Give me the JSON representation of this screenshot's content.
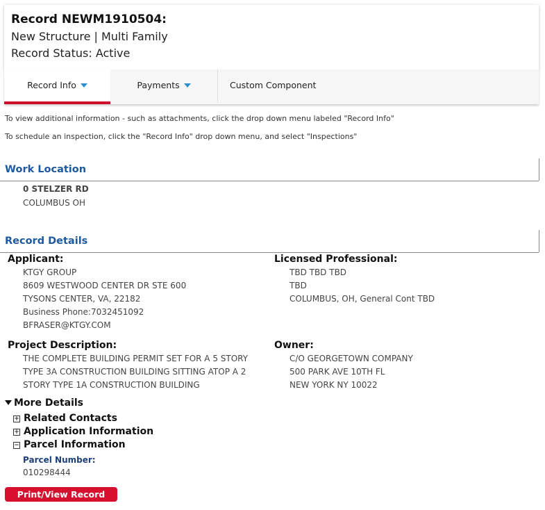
{
  "record": {
    "title": "Record NEWM1910504:",
    "type": "New Structure | Multi Family",
    "status": "Record Status: Active"
  },
  "tabs": [
    {
      "label": "Record Info"
    },
    {
      "label": "Payments"
    },
    {
      "label": "Custom Component"
    }
  ],
  "notes": {
    "line1": "To view additional information - such as attachments, click the drop down menu labeled \"Record Info\"",
    "line2": "To schedule an inspection, click the \"Record Info\" drop down menu, and select \"Inspections\""
  },
  "work_location": {
    "title": "Work Location",
    "address1": "0 STELZER RD",
    "address2": "COLUMBUS OH"
  },
  "record_details": {
    "title": "Record Details",
    "applicant": {
      "label": "Applicant:",
      "lines": [
        "KTGY GROUP",
        "8609 WESTWOOD CENTER DR STE 600",
        "TYSONS CENTER, VA, 22182",
        "Business Phone:7032451092",
        "BFRASER@KTGY.COM"
      ]
    },
    "licensed_professional": {
      "label": "Licensed Professional:",
      "lines": [
        "TBD TBD TBD",
        "TBD",
        "COLUMBUS, OH, General Cont TBD"
      ]
    },
    "project_description": {
      "label": "Project Description:",
      "lines": [
        "THE COMPLETE BUILDING PERMIT SET FOR A 5 STORY",
        "TYPE 3A CONSTRUCTION BUILDING SITTING ATOP A 2",
        "STORY TYPE 1A CONSTRUCTION BUILDING"
      ]
    },
    "owner": {
      "label": "Owner:",
      "lines": [
        "C/O GEORGETOWN COMPANY",
        "500 PARK AVE 10TH FL",
        "NEW YORK NY 10022"
      ]
    }
  },
  "more_details": {
    "label": "More Details",
    "related_contacts": "Related Contacts",
    "application_information": "Application Information",
    "parcel_information": "Parcel Information",
    "parcel_number_label": "Parcel Number:",
    "parcel_number": "010298444"
  },
  "print_button": "Print/View Record"
}
